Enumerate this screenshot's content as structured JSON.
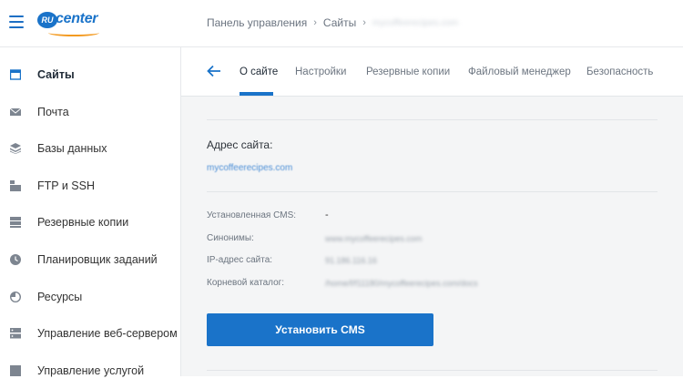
{
  "header": {
    "brand": {
      "ru": "RU",
      "center": "center"
    },
    "breadcrumbs": [
      "Панель управления",
      "Сайты",
      "mycoffeerecipes.com"
    ],
    "separator": "›"
  },
  "sidebar": {
    "items": [
      {
        "label": "Сайты",
        "icon": "sites-icon",
        "active": true
      },
      {
        "label": "Почта",
        "icon": "mail-icon"
      },
      {
        "label": "Базы данных",
        "icon": "database-icon"
      },
      {
        "label": "FTP и SSH",
        "icon": "ftp-icon"
      },
      {
        "label": "Резервные копии",
        "icon": "backup-icon"
      },
      {
        "label": "Планировщик заданий",
        "icon": "clock-icon"
      },
      {
        "label": "Ресурсы",
        "icon": "resources-icon"
      },
      {
        "label": "Управление веб-сервером",
        "icon": "server-icon"
      },
      {
        "label": "Управление услугой",
        "icon": "service-icon"
      }
    ]
  },
  "tabs": {
    "items": [
      {
        "label": "О сайте",
        "active": true
      },
      {
        "label": "Настройки"
      },
      {
        "label": "Резервные копии"
      },
      {
        "label": "Файловый менеджер"
      },
      {
        "label": "Безопасность"
      }
    ]
  },
  "site": {
    "address_label": "Адрес сайта:",
    "address": "mycoffeerecipes.com",
    "rows": [
      {
        "label": "Установленная CMS:",
        "value": "-"
      },
      {
        "label": "Синонимы:",
        "value": "www.mycoffeerecipes.com"
      },
      {
        "label": "IP-адрес сайта:",
        "value": "91.186.116.16"
      },
      {
        "label": "Корневой каталог:",
        "value": "/home/f/f11180/mycoffeerecipes.com/docs"
      }
    ],
    "install_button": "Установить CMS"
  },
  "colors": {
    "accent": "#1a73c9",
    "logo_orange": "#f39a21"
  }
}
